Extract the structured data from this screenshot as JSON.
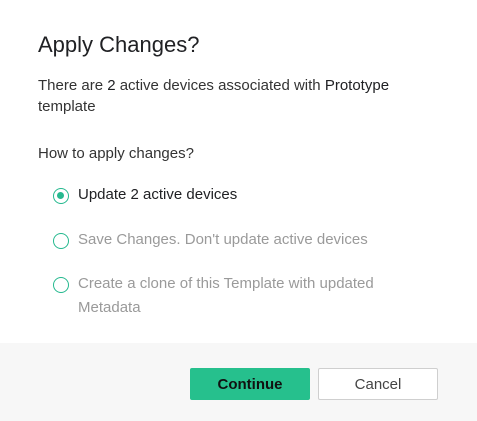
{
  "dialog": {
    "title": "Apply Changes?",
    "description": {
      "part1": "There are ",
      "count": "2",
      "part2": " active devices associated with ",
      "template_name": "Prototype",
      "part3": " template"
    },
    "question": "How to apply changes?",
    "options": [
      {
        "label": "Update 2 active devices",
        "selected": true,
        "enabled": true
      },
      {
        "label": "Save Changes. Don't update active devices",
        "selected": false,
        "enabled": false
      },
      {
        "label": "Create a clone of this Template with updated Metadata",
        "selected": false,
        "enabled": false
      }
    ],
    "buttons": {
      "continue_label": "Continue",
      "cancel_label": "Cancel"
    }
  },
  "colors": {
    "accent": "#26c08d",
    "footer_bg": "#f7f7f7",
    "disabled_text": "#9a9a9a"
  }
}
